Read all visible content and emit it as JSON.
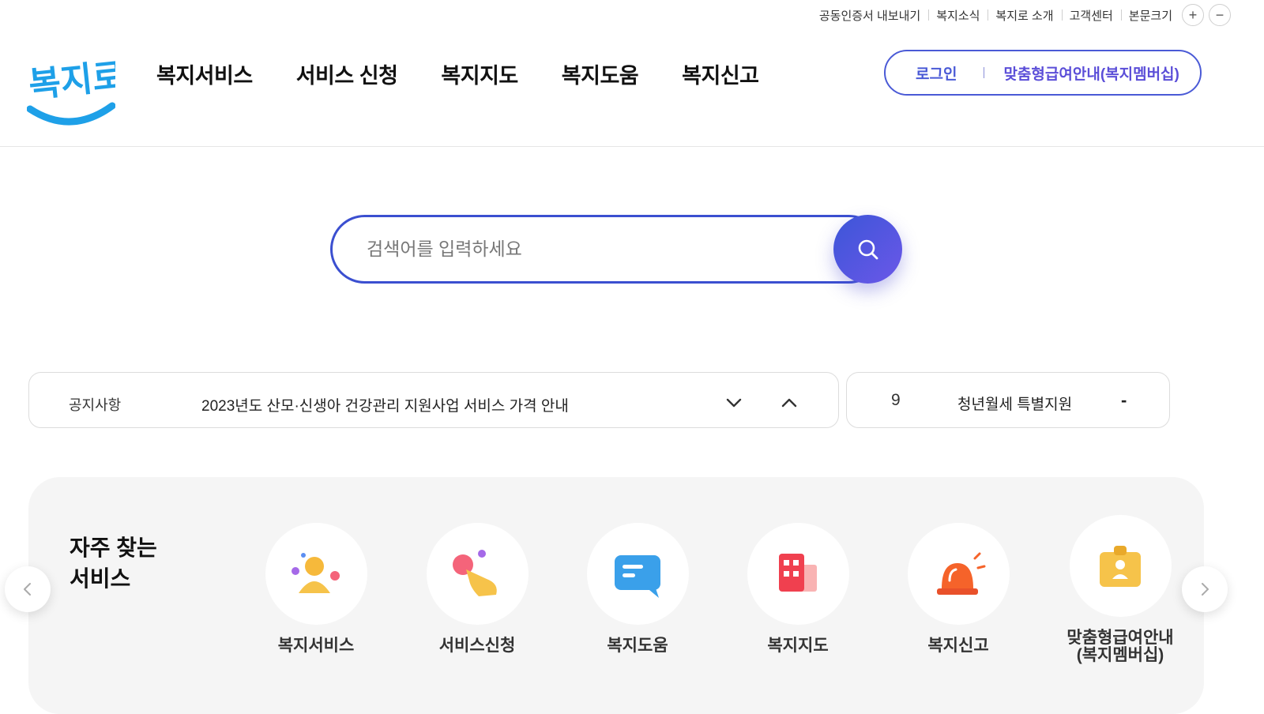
{
  "utility": {
    "links": [
      "공동인증서 내보내기",
      "복지소식",
      "복지로 소개",
      "고객센터"
    ],
    "font_size_label": "본문크기",
    "plus": "+",
    "minus": "−"
  },
  "brand": {
    "logo_text": "복지로",
    "color_primary": "#1ea0e8",
    "color_accent": "#3b4fd0"
  },
  "gnb": [
    "복지서비스",
    "서비스 신청",
    "복지지도",
    "복지도움",
    "복지신고"
  ],
  "auth": {
    "login": "로그인",
    "membership": "맞춤형급여안내(복지멤버십)"
  },
  "search": {
    "placeholder": "검색어를 입력하세요",
    "button_icon": "search-icon"
  },
  "notice": {
    "label": "공지사항",
    "text": "2023년도 산모·신생아 건강관리 지원사업 서비스 가격 안내"
  },
  "ranking": {
    "rank": "9",
    "keyword": "청년월세 특별지원",
    "change": "-"
  },
  "frequent": {
    "title_line1": "자주 찾는",
    "title_line2": "서비스",
    "items": [
      {
        "label": "복지서비스",
        "icon": "people-icon"
      },
      {
        "label": "서비스신청",
        "icon": "hand-click-icon"
      },
      {
        "label": "복지도움",
        "icon": "chat-bubble-icon"
      },
      {
        "label": "복지지도",
        "icon": "building-icon"
      },
      {
        "label": "복지신고",
        "icon": "siren-icon"
      },
      {
        "label_line1": "맞춤형급여안내",
        "label_line2": "(복지멤버십)",
        "icon": "id-badge-icon"
      }
    ]
  }
}
